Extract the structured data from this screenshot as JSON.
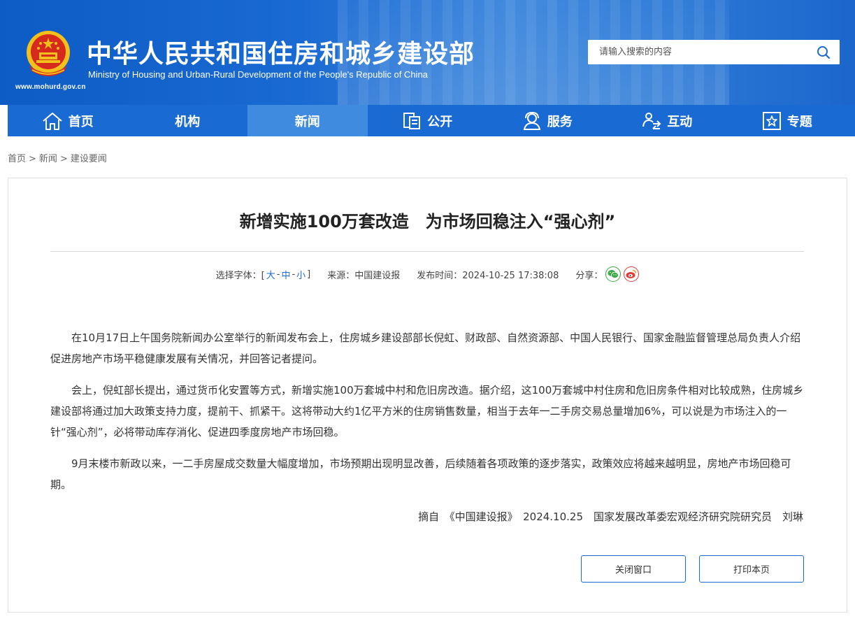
{
  "header": {
    "title": "中华人民共和国住房和城乡建设部",
    "subtitle": "Ministry of Housing and Urban-Rural Development of the People's Republic of China",
    "url": "www.mohurd.gov.cn",
    "search_placeholder": "请输入搜索的内容"
  },
  "colors": {
    "brand": "#1a6ad3",
    "nav_active": "#3f8be0",
    "emblem_red": "#d62a1e",
    "emblem_gold": "#f2c01a"
  },
  "nav": {
    "items": [
      {
        "label": "首页",
        "icon": "home-icon"
      },
      {
        "label": "机构",
        "icon": ""
      },
      {
        "label": "新闻",
        "icon": "",
        "active": true
      },
      {
        "label": "公开",
        "icon": "document-icon"
      },
      {
        "label": "服务",
        "icon": "service-person-icon"
      },
      {
        "label": "互动",
        "icon": "interaction-icon"
      },
      {
        "label": "专题",
        "icon": "star-frame-icon"
      }
    ]
  },
  "breadcrumb": {
    "items": [
      "首页",
      "新闻",
      "建设要闻"
    ],
    "separator": ">"
  },
  "article": {
    "title": "新增实施100万套改造　为市场回稳注入“强心剂”",
    "meta": {
      "font_label": "选择字体：[",
      "font_large": "大",
      "font_medium": "中",
      "font_small": "小",
      "font_close": "]",
      "dash": "-",
      "source": "来源：中国建设报",
      "publish_time": "发布时间：2024-10-25 17:38:08",
      "share_label": "分享："
    },
    "paragraphs": [
      "在10月17日上午国务院新闻办公室举行的新闻发布会上，住房城乡建设部部长倪虹、财政部、自然资源部、中国人民银行、国家金融监督管理总局负责人介绍促进房地产市场平稳健康发展有关情况，并回答记者提问。",
      "会上，倪虹部长提出，通过货币化安置等方式，新增实施100万套城中村和危旧房改造。据介绍，这100万套城中村住房和危旧房条件相对比较成熟，住房城乡建设部将通过加大政策支持力度，提前干、抓紧干。这将带动大约1亿平方米的住房销售数量，相当于去年一二手房交易总量增加6%，可以说是为市场注入的一针“强心剂”，必将带动库存消化、促进四季度房地产市场回稳。",
      "9月末楼市新政以来，一二手房屋成交数量大幅度增加，市场预期出现明显改善，后续随着各项政策的逐步落实，政策效应将越来越明显，房地产市场回稳可期。"
    ],
    "source_line": "摘自　《中国建设报》　2024.10.25　国家发展改革委宏观经济研究院研究员　刘琳",
    "close_button": "关闭窗口",
    "print_button": "打印本页"
  }
}
